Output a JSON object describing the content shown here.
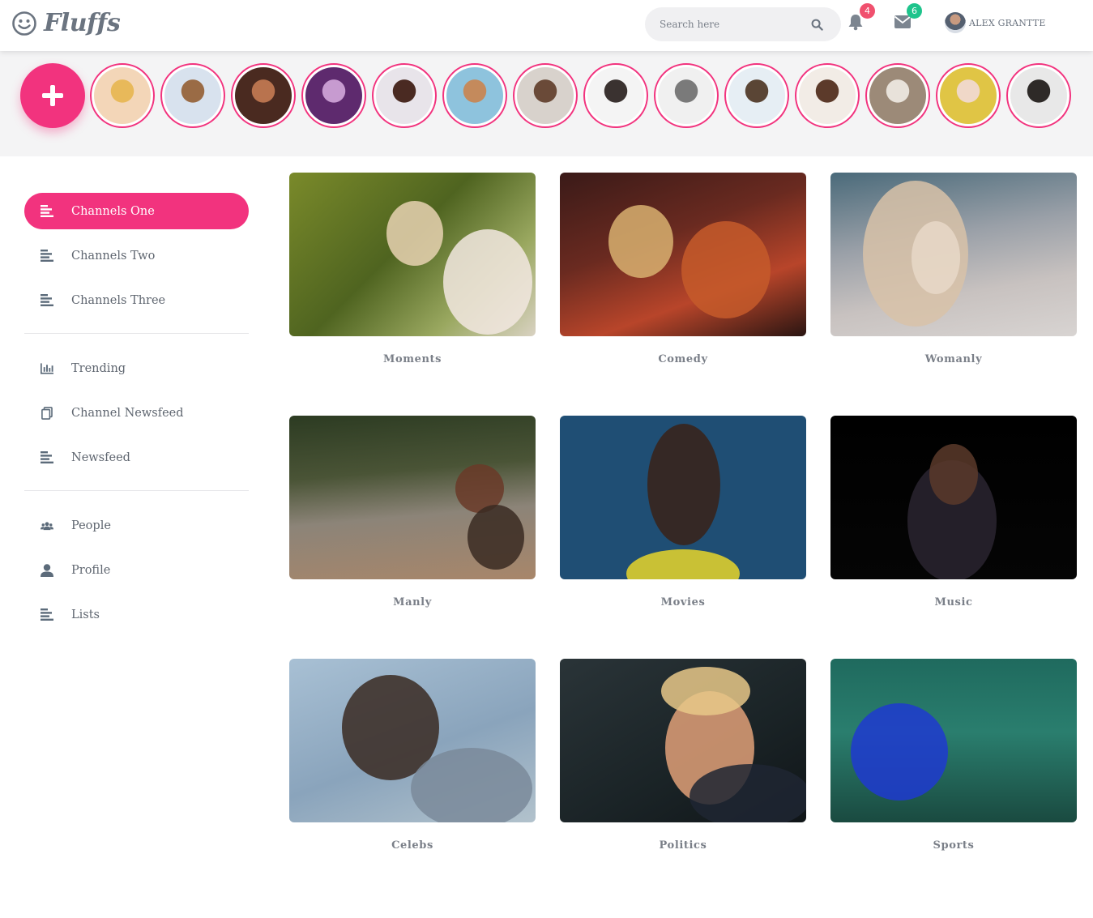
{
  "header": {
    "logo_text": "Fluffs",
    "search_placeholder": "Search here",
    "notifications_count": "4",
    "messages_count": "6",
    "user_name": "ALEX GRANTTE",
    "accent_color": "#f2337e",
    "notification_badge_color": "#f0506e",
    "message_badge_color": "#1ec48c"
  },
  "stories": {
    "add_icon": "plus-icon",
    "count": 14
  },
  "sidebar": {
    "groups": [
      [
        {
          "label": "Channels One",
          "icon": "list-icon",
          "active": true
        },
        {
          "label": "Channels Two",
          "icon": "list-icon",
          "active": false
        },
        {
          "label": "Channels Three",
          "icon": "list-icon",
          "active": false
        }
      ],
      [
        {
          "label": "Trending",
          "icon": "bar-chart-icon",
          "active": false
        },
        {
          "label": "Channel Newsfeed",
          "icon": "copy-icon",
          "active": false
        },
        {
          "label": "Newsfeed",
          "icon": "list-icon",
          "active": false
        }
      ],
      [
        {
          "label": "People",
          "icon": "users-icon",
          "active": false
        },
        {
          "label": "Profile",
          "icon": "user-icon",
          "active": false
        },
        {
          "label": "Lists",
          "icon": "list-icon",
          "active": false
        }
      ]
    ]
  },
  "channels": [
    {
      "title": "Moments"
    },
    {
      "title": "Comedy"
    },
    {
      "title": "Womanly"
    },
    {
      "title": "Manly"
    },
    {
      "title": "Movies"
    },
    {
      "title": "Music"
    },
    {
      "title": "Celebs"
    },
    {
      "title": "Politics"
    },
    {
      "title": "Sports"
    }
  ]
}
